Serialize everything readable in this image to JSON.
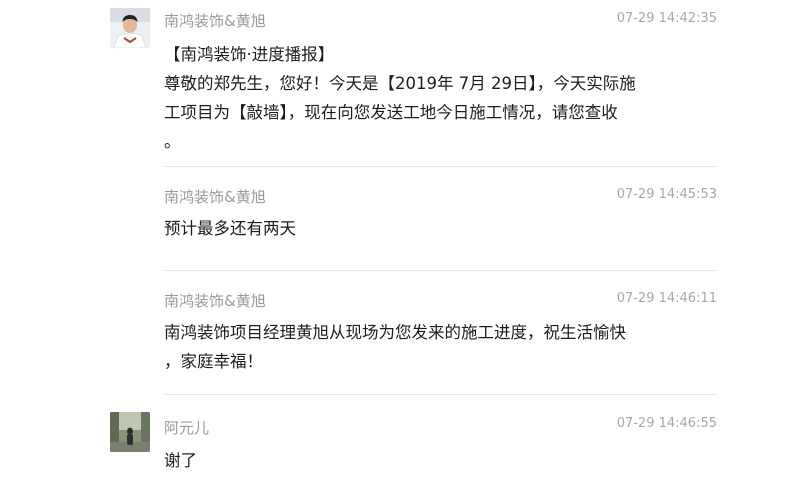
{
  "messages": [
    {
      "sender": "南鸿装饰&黄旭",
      "time": "07-29 14:42:35",
      "avatar": "user-avatar-photo",
      "lines": [
        "【南鸿装饰·进度播报】",
        "尊敬的郑先生，您好！今天是【2019年 7月 29日】，今天实际施",
        "工项目为【敲墙】，现在向您发送工地今日施工情况，请您查收",
        "。"
      ]
    },
    {
      "sender": "南鸿装饰&黄旭",
      "time": "07-29 14:45:53",
      "lines": [
        "预计最多还有两天"
      ]
    },
    {
      "sender": "南鸿装饰&黄旭",
      "time": "07-29 14:46:11",
      "lines": [
        "南鸿装饰项目经理黄旭从现场为您发来的施工进度，祝生活愉快",
        "，家庭幸福！"
      ]
    },
    {
      "sender": "阿元儿",
      "time": "07-29 14:46:55",
      "avatar": "user-avatar-photo",
      "lines": [
        "谢了"
      ]
    }
  ],
  "colors": {
    "sender": "#9a9a9a",
    "time": "#a8a8a8",
    "text": "#1d1d1d",
    "divider": "#e6e6e6"
  }
}
